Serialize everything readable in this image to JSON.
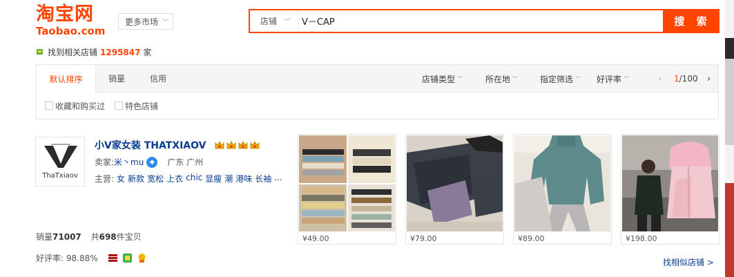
{
  "header": {
    "logo_cn": "淘宝网",
    "logo_en": "Taobao.com",
    "market_label": "更多市场",
    "search_type": "店铺",
    "search_value": "V－CAP",
    "search_button": "搜 索"
  },
  "found": {
    "prefix": "找到相关店铺",
    "count": "1295847",
    "suffix": "家"
  },
  "filter": {
    "sorts": [
      "默认排序",
      "销量",
      "信用"
    ],
    "dropdowns": [
      "店铺类型",
      "所在地",
      "指定筛选",
      "好评率"
    ],
    "pager": {
      "current": "1",
      "total": "/100"
    },
    "checks": [
      "收藏和购买过",
      "特色店铺"
    ]
  },
  "shop": {
    "logo_text": "ThaTxiaov",
    "name": "小V家女装 THATXIAOV",
    "crowns": 4,
    "seller_label": "卖家:",
    "seller_name": "米丶mu",
    "location": "广东 广州",
    "main_label": "主营:",
    "main_tags": [
      "女",
      "新款",
      "宽松",
      "上衣",
      "chic",
      "显瘦",
      "潮",
      "港味",
      "长袖",
      "..."
    ],
    "sales_label": "销量",
    "sales_value": "71007",
    "total_prefix": "共",
    "total_value": "698",
    "total_suffix": "件宝贝",
    "rating_label": "好评率:",
    "rating_value": "98.88%",
    "similar_link": "找相似店铺 >"
  },
  "products": [
    {
      "price": "¥49.00",
      "image": "folded-ribbed-knit-stacks"
    },
    {
      "price": "¥79.00",
      "image": "dark-jeans-velvet-lining"
    },
    {
      "price": "¥89.00",
      "image": "teal-sweater-grey-pants"
    },
    {
      "price": "¥198.00",
      "image": "pink-fur-hood-jacket"
    }
  ],
  "colors": {
    "accent": "#ff4400",
    "link": "#0a3d91"
  }
}
